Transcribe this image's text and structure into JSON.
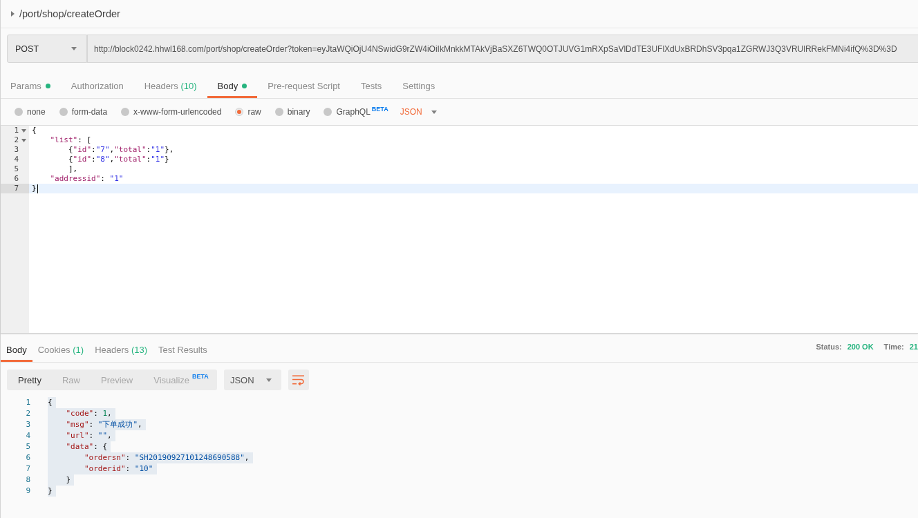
{
  "request": {
    "title": "/port/shop/createOrder",
    "expanded": false
  },
  "url_bar": {
    "method": "POST",
    "url": "http://block0242.hhwl168.com/port/shop/createOrder?token=eyJtaWQiOjU4NSwidG9rZW4iOiIkMnkkMTAkVjBaSXZ6TWQ0OTJUVG1mRXpSaVlDdTE3UFlXdUxBRDhSV3pqa1ZGRWJ3Q3VRUlRRekFMNi4ifQ%3D%3D"
  },
  "request_tabs": [
    {
      "label": "Params",
      "indicator": true,
      "selected": false
    },
    {
      "label": "Authorization",
      "indicator": false,
      "selected": false
    },
    {
      "label": "Headers",
      "count": "(10)",
      "indicator": false,
      "selected": false
    },
    {
      "label": "Body",
      "indicator": true,
      "selected": true
    },
    {
      "label": "Pre-request Script",
      "indicator": false,
      "selected": false
    },
    {
      "label": "Tests",
      "indicator": false,
      "selected": false
    },
    {
      "label": "Settings",
      "indicator": false,
      "selected": false
    }
  ],
  "body_types": [
    {
      "label": "none",
      "selected": false
    },
    {
      "label": "form-data",
      "selected": false
    },
    {
      "label": "x-www-form-urlencoded",
      "selected": false
    },
    {
      "label": "raw",
      "selected": true
    },
    {
      "label": "binary",
      "selected": false
    },
    {
      "label": "GraphQL",
      "badge": "BETA",
      "selected": false
    }
  ],
  "body_format": "JSON",
  "request_body": {
    "lines": [
      {
        "number": "1",
        "text": "{",
        "foldable": true,
        "active": false
      },
      {
        "number": "2",
        "text": "    \"list\": [",
        "foldable": true,
        "active": false
      },
      {
        "number": "3",
        "text": "        {\"id\":\"7\",\"total\":\"1\"},",
        "foldable": false,
        "active": false
      },
      {
        "number": "4",
        "text": "        {\"id\":\"8\",\"total\":\"1\"}",
        "foldable": false,
        "active": false
      },
      {
        "number": "5",
        "text": "        ],",
        "foldable": false,
        "active": false
      },
      {
        "number": "6",
        "text": "    \"addressid\": \"1\"",
        "foldable": false,
        "active": false
      },
      {
        "number": "7",
        "text": "}",
        "foldable": false,
        "active": true
      }
    ]
  },
  "response_tabs": [
    {
      "label": "Body",
      "selected": true
    },
    {
      "label": "Cookies",
      "count": "(1)",
      "selected": false
    },
    {
      "label": "Headers",
      "count": "(13)",
      "selected": false
    },
    {
      "label": "Test Results",
      "selected": false
    }
  ],
  "response_status": {
    "status_label": "Status:",
    "status": "200 OK",
    "time_label": "Time:",
    "time": "21"
  },
  "view_modes": [
    {
      "label": "Pretty",
      "selected": true
    },
    {
      "label": "Raw",
      "selected": false
    },
    {
      "label": "Preview",
      "selected": false
    },
    {
      "label": "Visualize",
      "badge": "BETA",
      "selected": false
    }
  ],
  "response_format": "JSON",
  "response_body": {
    "selected": true,
    "lines": [
      {
        "number": "1",
        "text": "{"
      },
      {
        "number": "2",
        "text": "    \"code\": 1,"
      },
      {
        "number": "3",
        "text": "    \"msg\": \"下单成功\","
      },
      {
        "number": "4",
        "text": "    \"url\": \"\","
      },
      {
        "number": "5",
        "text": "    \"data\": {"
      },
      {
        "number": "6",
        "text": "        \"ordersn\": \"SH20190927101248690588\","
      },
      {
        "number": "7",
        "text": "        \"orderid\": \"10\""
      },
      {
        "number": "8",
        "text": "    }"
      },
      {
        "number": "9",
        "text": "}"
      }
    ]
  }
}
